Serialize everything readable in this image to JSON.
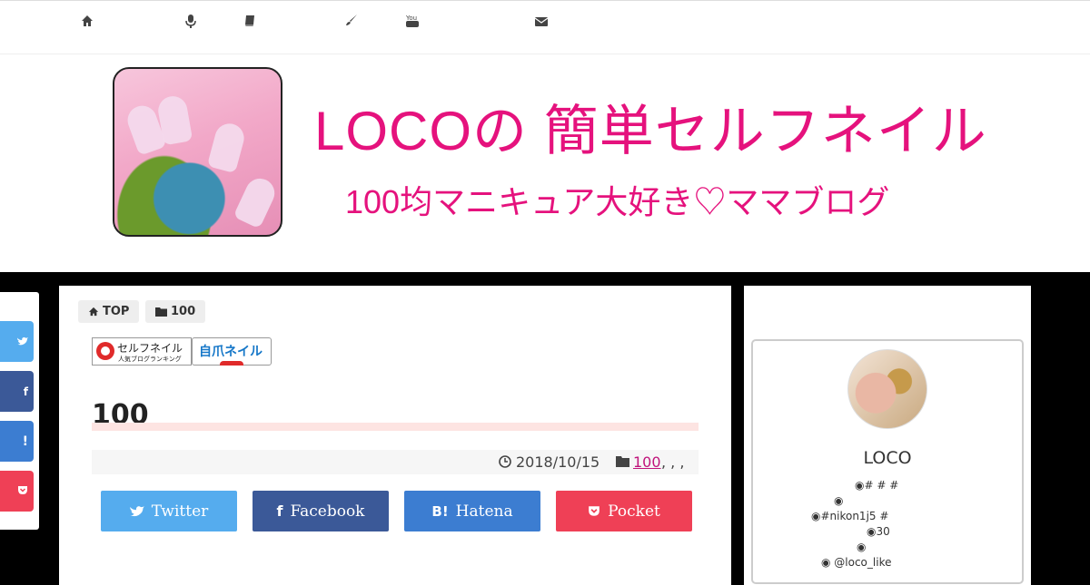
{
  "topnav": {
    "icons": [
      "home-icon",
      "microphone-icon",
      "book-icon",
      "brush-icon",
      "youtube-icon",
      "envelope-icon"
    ]
  },
  "header": {
    "title": "LOCOの 簡単セルフネイル",
    "subtitle": "100均マニキュア大好き♡ママブログ"
  },
  "share_rail": {
    "items": [
      {
        "icon": "twitter-icon",
        "color": "#55acee",
        "glyph": "🐦"
      },
      {
        "icon": "facebook-icon",
        "color": "#3b5998",
        "glyph": "f"
      },
      {
        "icon": "hatena-icon",
        "color": "#3c7dd1",
        "glyph": "!"
      },
      {
        "icon": "pocket-icon",
        "color": "#ef4056",
        "glyph": "🅟"
      }
    ]
  },
  "breadcrumb": {
    "top_label": "TOP",
    "category_label": "100"
  },
  "banners": {
    "blog_ranking_main": "セルフネイル",
    "blog_ranking_sub": "人気ブログランキング",
    "nail_banner": "自爪ネイル"
  },
  "post": {
    "title": "100",
    "date": "2018/10/15",
    "category_link": "100",
    "tags_suffix": ", , ,"
  },
  "share_buttons": [
    {
      "label": "Twitter",
      "icon": "twitter-icon",
      "color": "#55acee"
    },
    {
      "label": "Facebook",
      "icon": "facebook-icon",
      "color": "#3b5998"
    },
    {
      "label": "Hatena",
      "icon": "hatena-icon",
      "color": "#3c7dd1"
    },
    {
      "label": "Pocket",
      "icon": "pocket-icon",
      "color": "#ef4056"
    }
  ],
  "profile": {
    "name": "LOCO",
    "lines": [
      "◉# # #",
      "◉",
      "◉#nikon1j5 #",
      "◉30",
      "◉",
      "◉ @loco_like"
    ]
  },
  "colors": {
    "accent": "#e5127d",
    "link": "#c0137b",
    "title_underline": "#fde4e2"
  }
}
